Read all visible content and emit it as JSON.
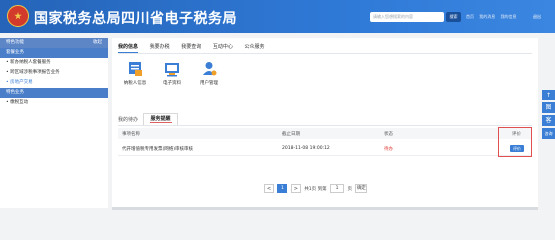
{
  "header": {
    "title": "国家税务总局四川省电子税务局",
    "search_placeholder": "请输入您想搜索的内容",
    "search_button": "搜索",
    "links": [
      "首页",
      "我的消息",
      "我的信息"
    ],
    "right_text": "退出"
  },
  "sidebar": {
    "head_label": "特色功能",
    "collapse_label": "收起",
    "group1": "套餐业务",
    "items": [
      "新办纳税人套餐服务",
      "跨区域涉税事项报告业务",
      "房地产交易"
    ],
    "group2": "特色业务",
    "items2": [
      "缴税互动"
    ]
  },
  "tabs": [
    "我的信息",
    "我要办税",
    "我要查询",
    "互动中心",
    "公众服务"
  ],
  "quick_links": [
    {
      "label": "纳税人信息",
      "icon": "taxpayer-info-icon"
    },
    {
      "label": "电子资料",
      "icon": "e-document-icon"
    },
    {
      "label": "用户管理",
      "icon": "user-management-icon"
    }
  ],
  "subtabs": {
    "first": "我的待办",
    "active": "服务提醒"
  },
  "table": {
    "headers": [
      "事项名称",
      "截止日期",
      "状态",
      "评价"
    ],
    "rows": [
      {
        "name": "代开增值税专用发票(网络)审核审核",
        "deadline": "2018-11-08 19:00:12",
        "status": "待办",
        "action": "评价"
      }
    ]
  },
  "pager": {
    "prev": "<",
    "current": "1",
    "next": ">",
    "total": "共1页",
    "goto": "到第",
    "page_value": "1",
    "page_unit": "页",
    "confirm": "确定"
  },
  "float_bar": [
    "↑",
    "图",
    "客",
    "咨询"
  ],
  "colors": {
    "header": "#2f79d6",
    "accent": "#3a7fd5",
    "status_red": "#e0403a"
  }
}
